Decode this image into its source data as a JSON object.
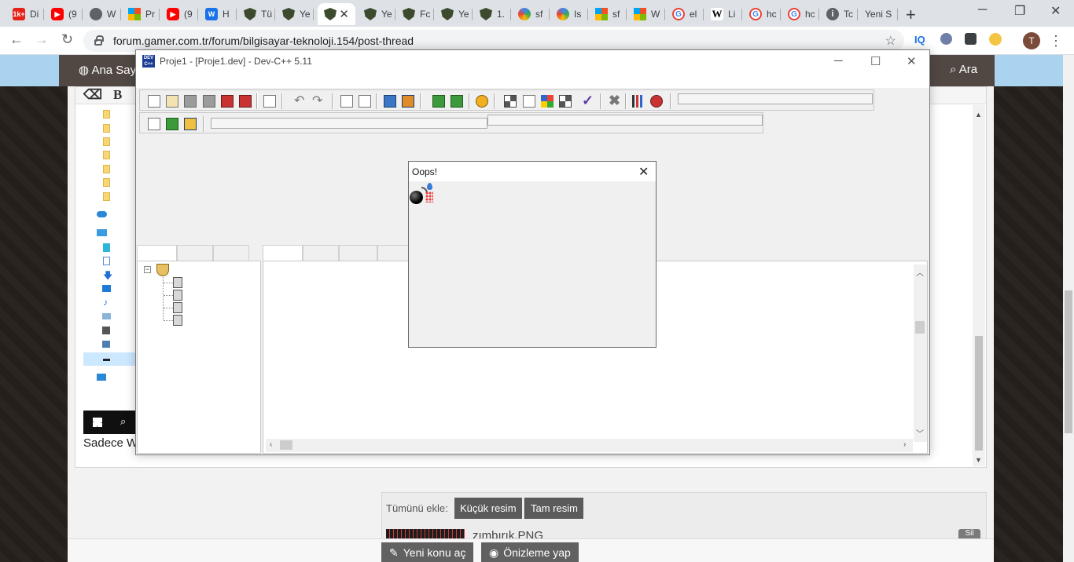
{
  "browser": {
    "tabs": [
      {
        "icon": "youtube-counter-icon",
        "badge": "1k+",
        "label": "Di"
      },
      {
        "icon": "youtube-icon",
        "label": "(9"
      },
      {
        "icon": "globe-icon",
        "label": "W"
      },
      {
        "icon": "microsoft-icon",
        "label": "Pr"
      },
      {
        "icon": "youtube-icon",
        "label": "(9"
      },
      {
        "icon": "w-icon",
        "label": "H"
      },
      {
        "icon": "shield-icon",
        "label": "Tü"
      },
      {
        "icon": "shield-icon",
        "label": "Ye"
      },
      {
        "icon": "shield-icon",
        "label": "",
        "active": true
      },
      {
        "icon": "shield-icon",
        "label": "Ye"
      },
      {
        "icon": "shield-icon",
        "label": "Fc"
      },
      {
        "icon": "shield-icon",
        "label": "Ye"
      },
      {
        "icon": "shield-icon",
        "label": "1."
      },
      {
        "icon": "swirl-icon",
        "label": "sf"
      },
      {
        "icon": "swirl-icon",
        "label": "Is"
      },
      {
        "icon": "microsoft-icon",
        "label": "sf"
      },
      {
        "icon": "microsoft-icon",
        "label": "W"
      },
      {
        "icon": "google-icon",
        "label": "el"
      },
      {
        "icon": "wikipedia-icon",
        "label": "Li"
      },
      {
        "icon": "google-icon",
        "label": "hc"
      },
      {
        "icon": "google-icon",
        "label": "hc"
      },
      {
        "icon": "info-icon",
        "label": "Tc"
      },
      {
        "icon": "",
        "label": "Yeni S"
      }
    ],
    "url": "forum.gamer.com.tr/forum/bilgisayar-teknoloji.154/post-thread",
    "profile_initial": "T",
    "ext_iq": "IQ"
  },
  "forum": {
    "nav_home": "Ana Say",
    "nav_search": "Ara",
    "sadece_text": "Sadece W",
    "tumunu_ekle": "Tümünü ekle:",
    "kucuk_resim": "Küçük resim",
    "tam_resim": "Tam resim",
    "attachment_name": "zımbırık.PNG",
    "sil": "Sil",
    "yeni_konu": "Yeni konu aç",
    "onizleme": "Önizleme yap"
  },
  "devcpp": {
    "title": "Proje1 - [Proje1.dev] - Dev-C++ 5.11",
    "logo_text": "DEV C++"
  },
  "dialog": {
    "title": "Oops!"
  }
}
